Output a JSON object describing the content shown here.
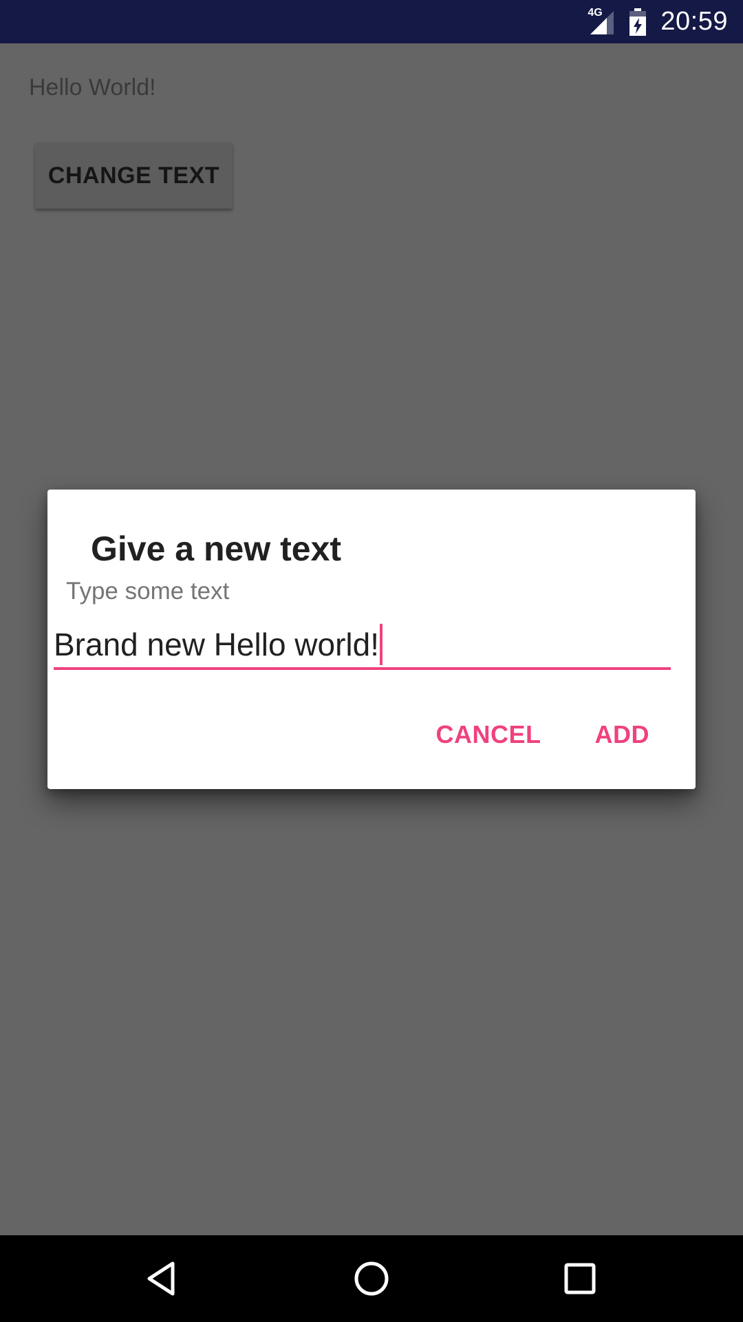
{
  "status_bar": {
    "network": "4G",
    "time": "20:59",
    "icons": [
      "signal-icon",
      "battery-charging-icon"
    ]
  },
  "app": {
    "hello_text": "Hello World!",
    "change_button": "CHANGE TEXT"
  },
  "dialog": {
    "title": "Give a new text",
    "message": "Type some text",
    "input_value": "Brand new Hello world!",
    "cancel_label": "CANCEL",
    "add_label": "ADD",
    "accent_color": "#f0417f"
  },
  "nav_bar": {
    "icons": [
      "back-icon",
      "home-icon",
      "recents-icon"
    ]
  }
}
